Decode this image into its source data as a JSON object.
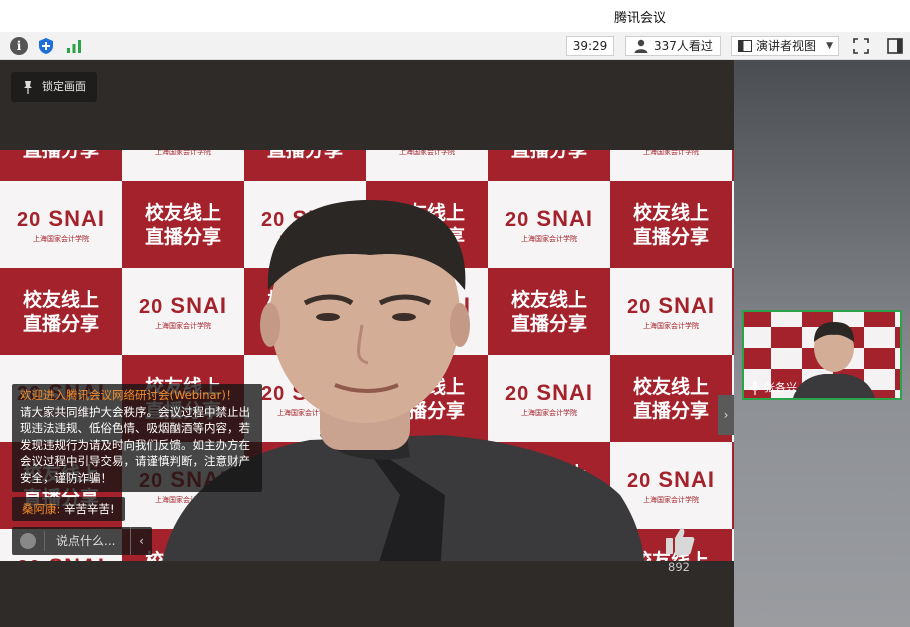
{
  "window": {
    "title": "腾讯会议"
  },
  "toolbar": {
    "timer": "39:29",
    "viewers": "337人看过",
    "view_mode": "演讲者视图"
  },
  "stage": {
    "lock_label": "锁定画面",
    "backdrop": {
      "red_text_line1": "校友线上",
      "red_text_line2": "直播分享",
      "logo_text": "SNAI",
      "logo_num": "20",
      "logo_sub": "上海国家会计学院"
    }
  },
  "chat": {
    "welcome_highlight": "欢迎进入腾讯会议网络研讨会(Webinar)！",
    "welcome_body": "请大家共同维护大会秩序。会议过程中禁止出现违法违规、低俗色情、吸烟酗酒等内容，若发现违规行为请及时向我们反馈。如主办方在会议过程中引导交易，请谨慎判断，注意财产安全，谨防诈骗！",
    "message_user": "桑阿康:",
    "message_text": " 辛苦辛苦!",
    "input_placeholder": "说点什么..."
  },
  "likes": {
    "count": "892"
  },
  "participant": {
    "name": "张各兴"
  },
  "colors": {
    "brand_red": "#a3222b",
    "accent_orange": "#f08c2c",
    "active_green": "#2aa34a"
  }
}
